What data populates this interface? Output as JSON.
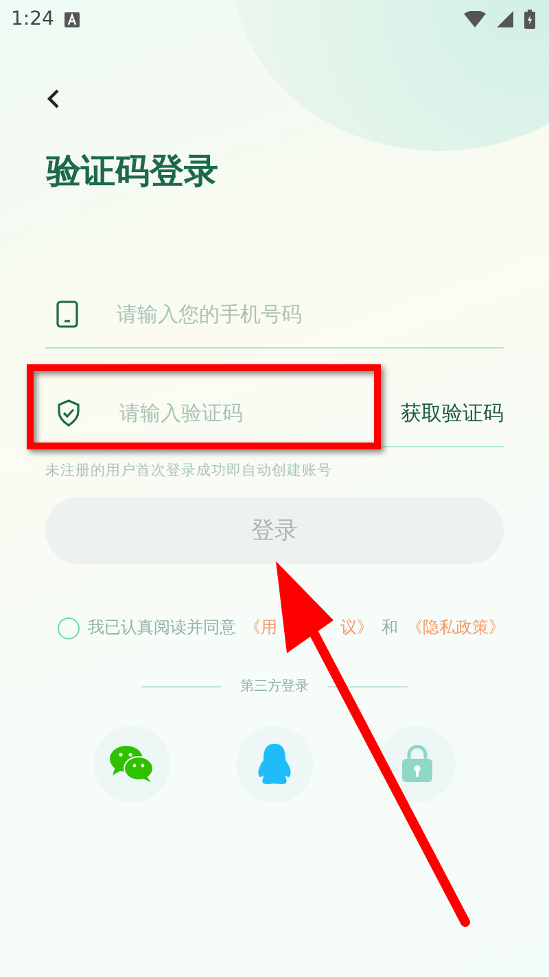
{
  "status_bar": {
    "time": "1:24"
  },
  "title": "验证码登录",
  "phone_field": {
    "placeholder": "请输入您的手机号码"
  },
  "code_field": {
    "placeholder": "请输入验证码"
  },
  "get_code_button": "获取验证码",
  "hint": "未注册的用户首次登录成功即自动创建账号",
  "login_button": {
    "label": "登录",
    "disabled": true
  },
  "agreement": {
    "checked": false,
    "text": "我已认真阅读并同意",
    "links": [
      {
        "parts": [
          "《用",
          "议》"
        ]
      },
      {
        "parts": [
          "《隐私政策》"
        ]
      }
    ],
    "joiner": "和"
  },
  "third_party": {
    "label": "第三方登录",
    "options": [
      {
        "kind": "chat"
      },
      {
        "kind": "penguin"
      },
      {
        "kind": "lock"
      }
    ]
  }
}
